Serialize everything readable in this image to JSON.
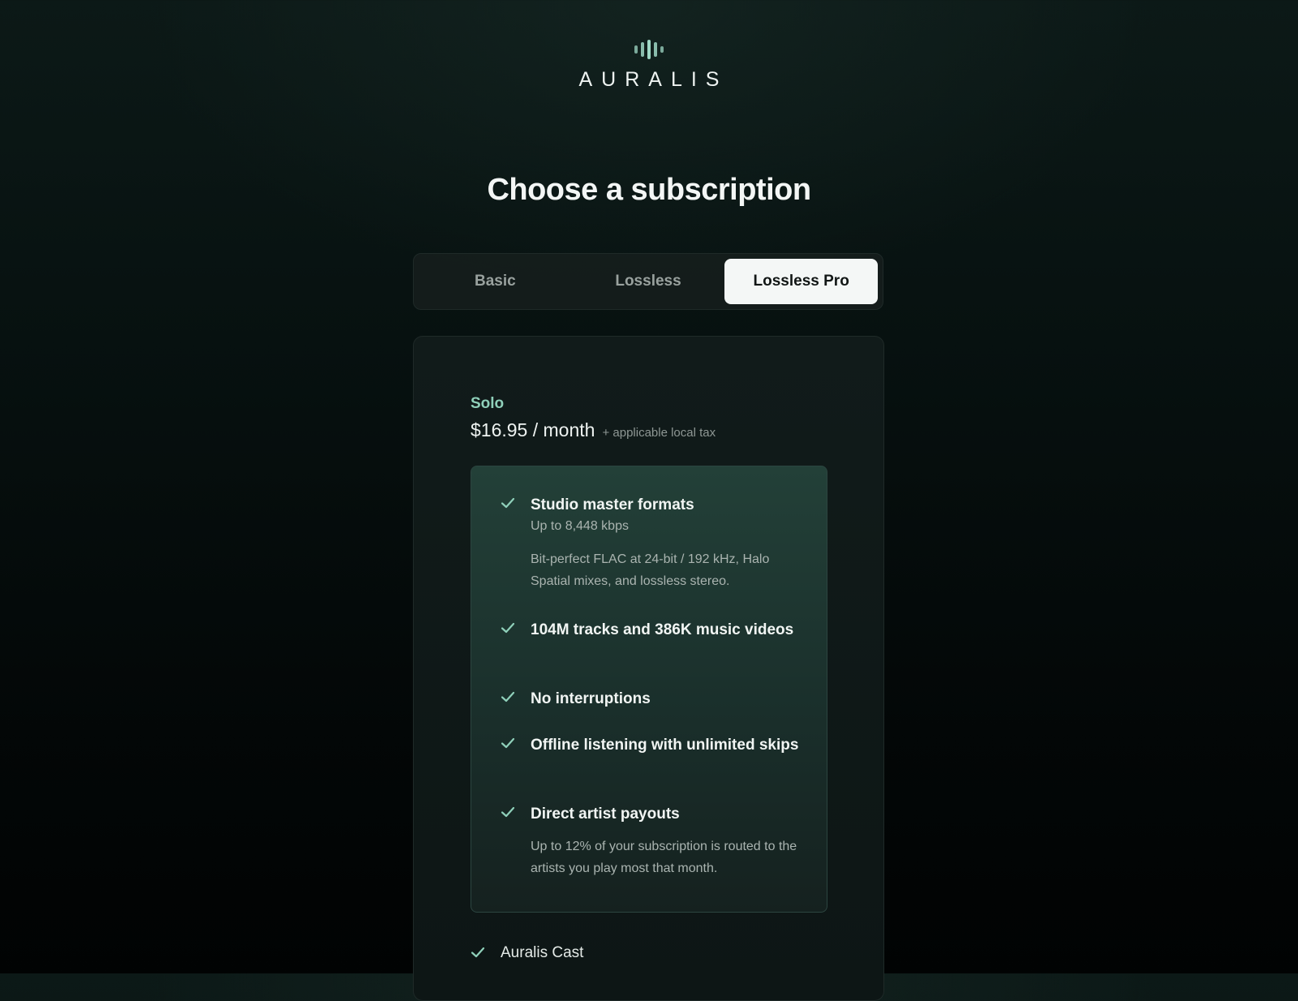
{
  "brand": {
    "name": "AURALIS",
    "accent_color": "#9fd8c6"
  },
  "page_title": "Choose a subscription",
  "tabs": [
    {
      "label": "Basic",
      "active": false
    },
    {
      "label": "Lossless",
      "active": false
    },
    {
      "label": "Lossless Pro",
      "active": true
    }
  ],
  "plan": {
    "tier": "Solo",
    "price": "$16.95 / month",
    "tax_note": "+ applicable local tax",
    "features": [
      {
        "title": "Studio master formats",
        "subtitle": "Up to 8,448 kbps",
        "description": "Bit-perfect FLAC at 24-bit / 192 kHz, Halo Spatial mixes, and lossless stereo.",
        "icon": "check-icon"
      },
      {
        "title": "104M tracks and 386K music videos",
        "icon": "check-icon"
      },
      {
        "title": "No interruptions",
        "icon": "check-icon"
      },
      {
        "title": "Offline listening with unlimited skips",
        "icon": "check-icon"
      },
      {
        "title": "Direct artist payouts",
        "description": "Up to 12% of your subscription is routed to the artists you play most that month.",
        "icon": "check-icon"
      }
    ],
    "extras": [
      {
        "label": "Auralis Cast",
        "icon": "check-icon"
      }
    ]
  },
  "colors": {
    "accent": "#8fd0ba",
    "check": "#8fd0ba",
    "tab_active_bg": "#f4f7f6"
  }
}
